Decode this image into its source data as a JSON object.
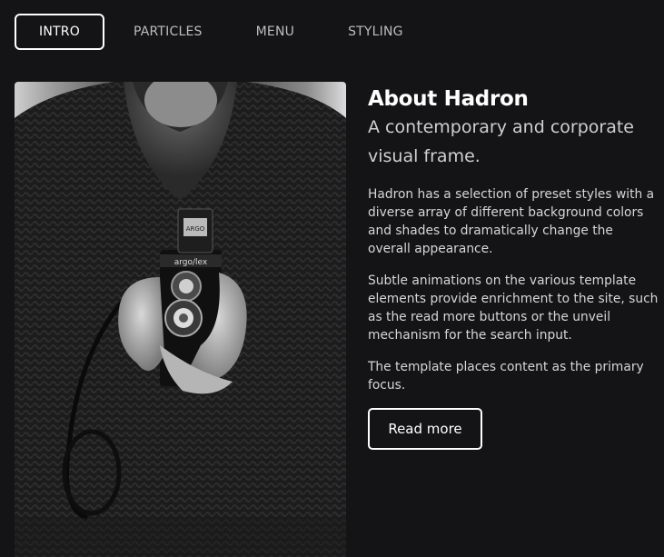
{
  "tabs": [
    {
      "label": "INTRO",
      "active": true
    },
    {
      "label": "PARTICLES",
      "active": false
    },
    {
      "label": "MENU",
      "active": false
    },
    {
      "label": "STYLING",
      "active": false
    }
  ],
  "about": {
    "title": "About Hadron",
    "subtitle": "A contemporary and corporate visual frame.",
    "paragraphs": [
      "Hadron has a selection of preset styles with a diverse array of different background colors and shades to dramatically change the overall appearance.",
      "Subtle animations on the various template elements provide enrichment to the site, such as the read more buttons or the unveil mechanism for the search input.",
      "The template places content as the primary focus."
    ],
    "button_label": "Read more"
  },
  "photo": {
    "camera_label": "argo/lex"
  },
  "colors": {
    "background": "#141416",
    "text": "#ffffff",
    "muted": "#bdbdbd"
  }
}
